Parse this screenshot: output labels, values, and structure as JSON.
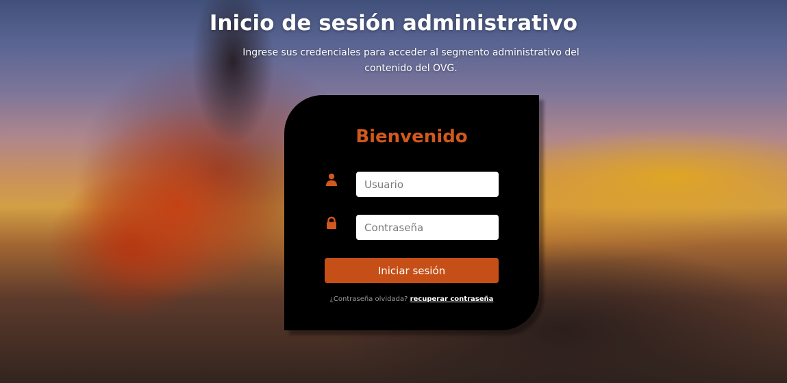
{
  "header": {
    "title": "Inicio de sesión administrativo",
    "subtitle": "Ingrese sus credenciales para acceder al segmento administrativo del contenido del OVG."
  },
  "login_card": {
    "welcome": "Bienvenido",
    "username": {
      "placeholder": "Usuario",
      "value": "",
      "icon": "user-icon"
    },
    "password": {
      "placeholder": "Contraseña",
      "value": "",
      "icon": "lock-icon"
    },
    "submit_label": "Iniciar sesión",
    "forgot_prompt": "¿Contraseña olvidada?",
    "forgot_link": "recuperar contraseña"
  },
  "colors": {
    "accent": "#c64f17",
    "welcome_text": "#d2581c",
    "card_background": "#000000"
  }
}
